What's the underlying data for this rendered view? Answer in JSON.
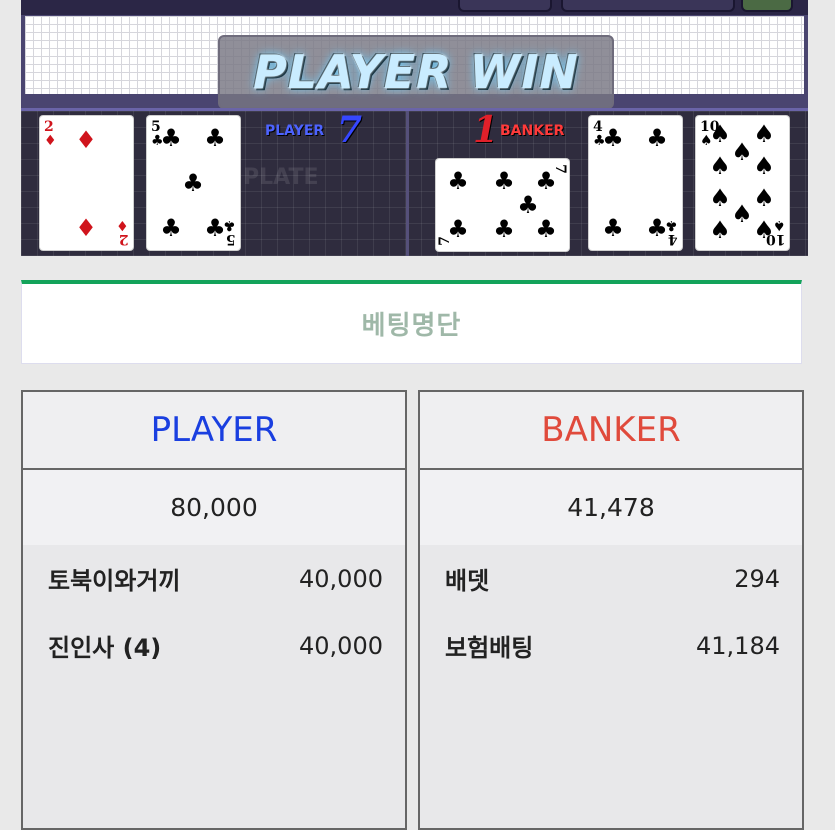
{
  "game": {
    "result_banner": "PLAYER WIN",
    "plate_text": "PLATE",
    "player": {
      "label": "PLAYER",
      "score": "7",
      "color": "#2b33e0"
    },
    "banker": {
      "label": "BANKER",
      "score": "1",
      "color": "#e0202a"
    },
    "player_cards": [
      {
        "rank": "2",
        "suit": "♦",
        "suit_name": "diamonds"
      },
      {
        "rank": "5",
        "suit": "♣",
        "suit_name": "clubs"
      }
    ],
    "banker_cards": [
      {
        "rank": "7",
        "suit": "♣",
        "suit_name": "clubs"
      },
      {
        "rank": "4",
        "suit": "♣",
        "suit_name": "clubs"
      },
      {
        "rank": "10",
        "suit": "♠",
        "suit_name": "spades"
      }
    ]
  },
  "betting_list": {
    "title": "베팅명단",
    "accent": "#13a35a"
  },
  "panels": {
    "player": {
      "title": "PLAYER",
      "title_color": "#1a3fe0",
      "total": "80,000",
      "entries": [
        {
          "name": "토북이와거끼",
          "amount": "40,000"
        },
        {
          "name": "진인사 (4)",
          "amount": "40,000"
        }
      ]
    },
    "banker": {
      "title": "BANKER",
      "title_color": "#e04a3c",
      "total": "41,478",
      "entries": [
        {
          "name": "배뎃",
          "amount": "294"
        },
        {
          "name": "보험배팅",
          "amount": "41,184"
        }
      ]
    }
  }
}
